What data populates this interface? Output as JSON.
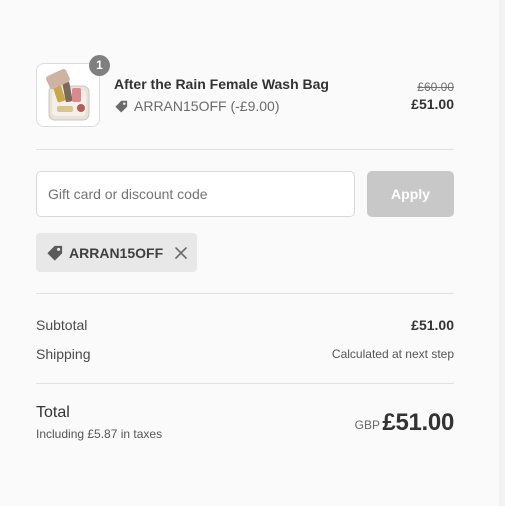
{
  "product": {
    "quantity": "1",
    "title": "After the Rain Female Wash Bag",
    "discount_line": "ARRAN15OFF (-£9.00)",
    "original_price": "£60.00",
    "price": "£51.00",
    "image_icon": "wash-bag-thumbnail"
  },
  "discount_form": {
    "placeholder": "Gift card or discount code",
    "value": "",
    "apply_label": "Apply"
  },
  "applied_code": {
    "label": "ARRAN15OFF",
    "tag_icon": "tag-icon",
    "remove_icon": "close-icon"
  },
  "summary": {
    "subtotal_label": "Subtotal",
    "subtotal_value": "£51.00",
    "shipping_label": "Shipping",
    "shipping_value": "Calculated at next step"
  },
  "total": {
    "label": "Total",
    "tax_note": "Including £5.87 in taxes",
    "currency": "GBP",
    "value": "£51.00"
  },
  "colors": {
    "background": "#fafafa",
    "apply_disabled": "#c8c8c8",
    "chip_background": "#e8e8e8",
    "badge": "#7f7f7f"
  }
}
